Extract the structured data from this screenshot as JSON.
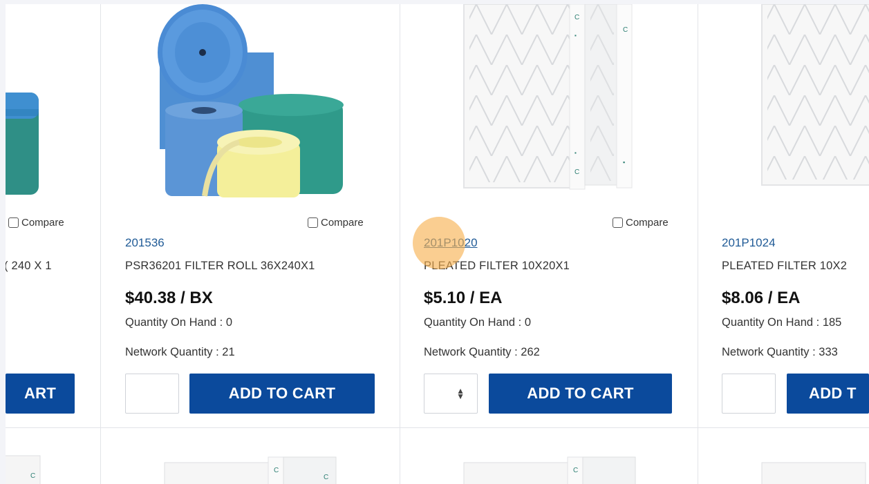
{
  "compare_label": "Compare",
  "products": [
    {
      "sku": "",
      "description": "( 240 X 1",
      "price": "",
      "qoh": "",
      "network": "",
      "button": "ART",
      "qty_value": ""
    },
    {
      "sku": "201536",
      "description": "PSR36201 FILTER ROLL 36X240X1",
      "price": "$40.38 / BX",
      "qoh": "Quantity On Hand : 0",
      "network": "Network Quantity : 21",
      "button": "ADD TO CART",
      "qty_value": ""
    },
    {
      "sku": "201P1020",
      "description": "PLEATED FILTER 10X20X1",
      "price": "$5.10 / EA",
      "qoh": "Quantity On Hand : 0",
      "network": "Network Quantity : 262",
      "button": "ADD TO CART",
      "qty_value": ""
    },
    {
      "sku": "201P1024",
      "description": "PLEATED FILTER 10X2",
      "price": "$8.06 / EA",
      "qoh": "Quantity On Hand : 185",
      "network": "Network Quantity : 333",
      "button": "ADD T",
      "qty_value": ""
    }
  ],
  "colors": {
    "link": "#1f5a96",
    "button": "#0b4a9c",
    "cursor_highlight": "#f7b04d"
  }
}
